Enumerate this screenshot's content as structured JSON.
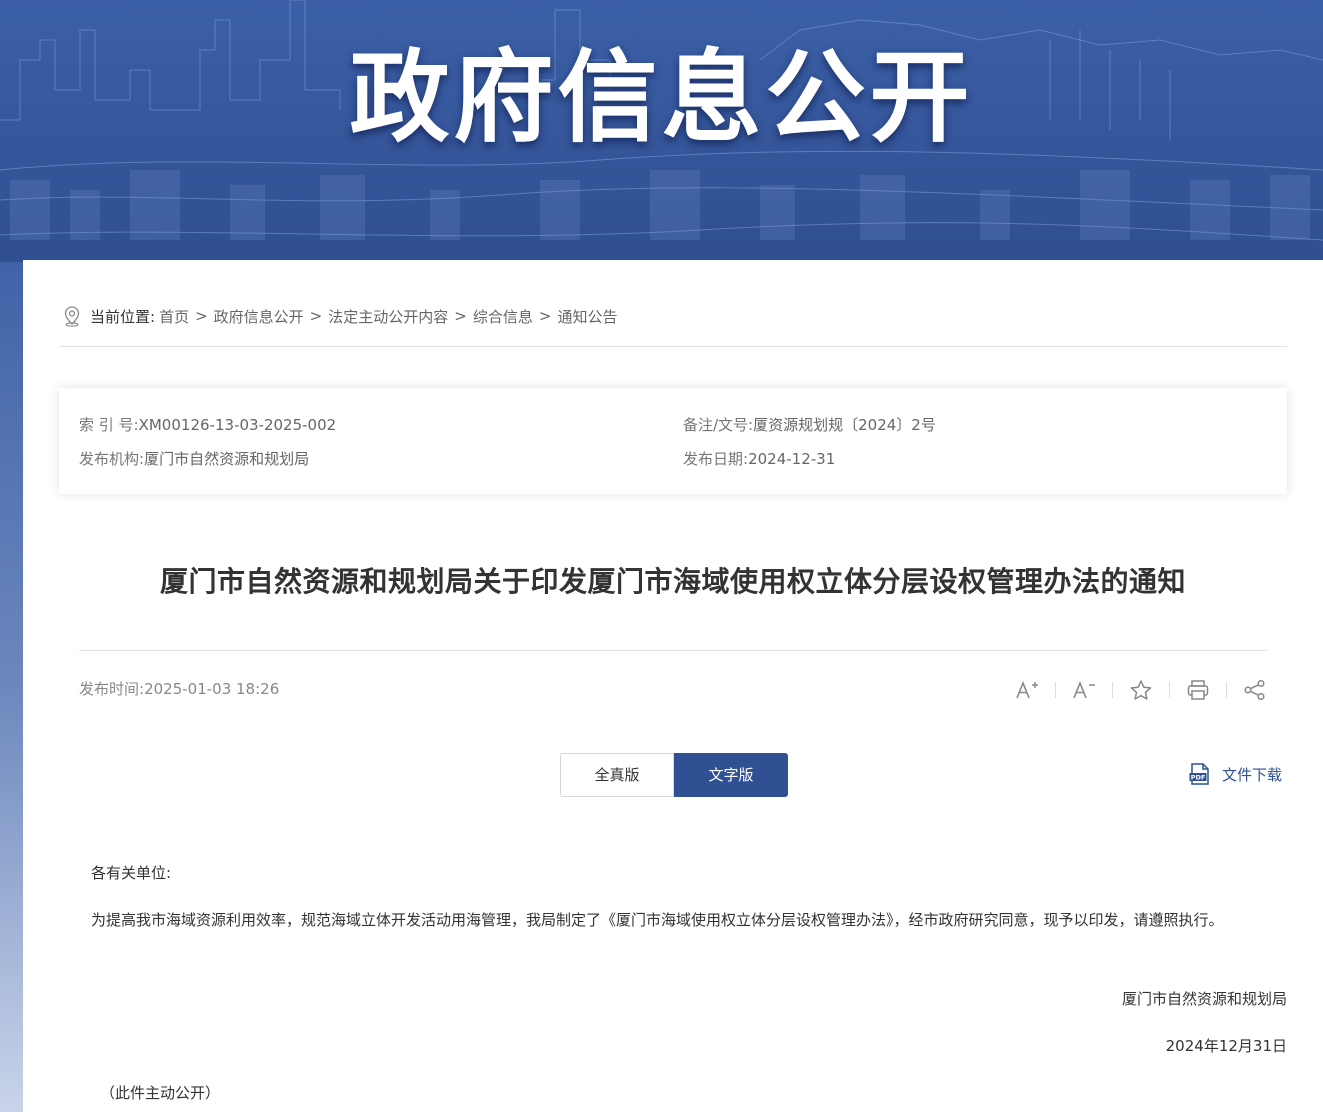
{
  "banner": {
    "title": "政府信息公开"
  },
  "breadcrumb": {
    "lead": "当前位置:",
    "items": [
      "首页",
      "政府信息公开",
      "法定主动公开内容",
      "综合信息",
      "通知公告"
    ],
    "separator": ">"
  },
  "meta": {
    "index_label": "索 引 号:",
    "index_value": "XM00126-13-03-2025-002",
    "doc_label": "备注/文号:",
    "doc_value": "厦资源规划规〔2024〕2号",
    "org_label": "发布机构:",
    "org_value": "厦门市自然资源和规划局",
    "date_label": "发布日期:",
    "date_value": "2024-12-31"
  },
  "article": {
    "title": "厦门市自然资源和规划局关于印发厦门市海域使用权立体分层设权管理办法的通知",
    "pubtime_label": "发布时间:",
    "pubtime_value": "2025-01-03 18:26",
    "salutation": "各有关单位:",
    "paragraph": "为提高我市海域资源利用效率，规范海域立体开发活动用海管理，我局制定了《厦门市海域使用权立体分层设权管理办法》，经市政府研究同意，现予以印发，请遵照执行。",
    "signature": "厦门市自然资源和规划局",
    "sign_date": "2024年12月31日",
    "note": "（此件主动公开）"
  },
  "tools": [
    "font-increase-icon",
    "font-decrease-icon",
    "star-icon",
    "print-icon",
    "share-icon"
  ],
  "tabs": {
    "full": "全真版",
    "text": "文字版",
    "active": "text"
  },
  "download": {
    "label": "文件下载",
    "icon": "pdf-icon"
  },
  "colors": {
    "banner": "#3b5fa6",
    "accent": "#2f5194",
    "text": "#333333",
    "muted": "#888888"
  }
}
